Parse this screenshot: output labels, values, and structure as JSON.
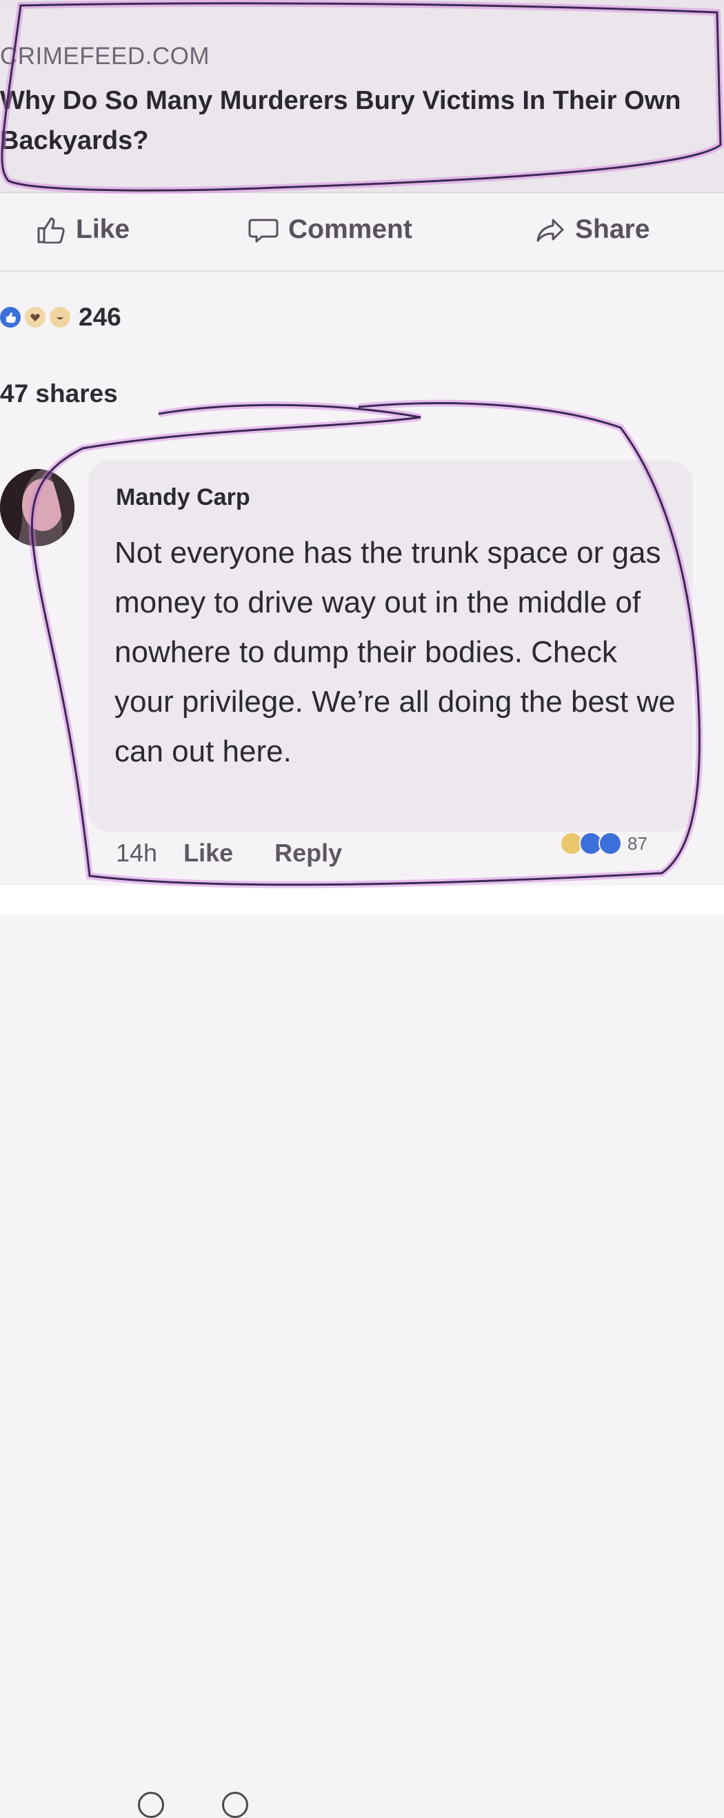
{
  "link_preview": {
    "domain": "CRIMEFEED.COM",
    "headline": "Why Do So Many Murderers Bury Victims In Their Own Backyards?"
  },
  "actions": {
    "like_label": "Like",
    "comment_label": "Comment",
    "share_label": "Share"
  },
  "post_stats": {
    "reaction_icons": [
      "like-reaction-icon",
      "love-reaction-icon",
      "haha-reaction-icon"
    ],
    "reaction_count": "246",
    "shares": "47 shares"
  },
  "comment": {
    "author": "Mandy Carp",
    "text": "Not everyone has the trunk space or gas money to drive way out in the middle of nowhere to dump their bodies. Check your privilege. We’re all doing the best we can out here.",
    "time": "14h",
    "like_label": "Like",
    "reply_label": "Reply",
    "reaction_icons": [
      "haha-reaction-icon",
      "like-reaction-icon",
      "love-reaction-icon"
    ],
    "reaction_count": "87"
  },
  "colors": {
    "background": "#f6f3f7",
    "card": "#ebe6ec",
    "bubble": "#ece8ee",
    "accent_like": "#3b6fd9",
    "annotation_ink": "#3a2a52",
    "annotation_glow": "#d47ee0"
  }
}
